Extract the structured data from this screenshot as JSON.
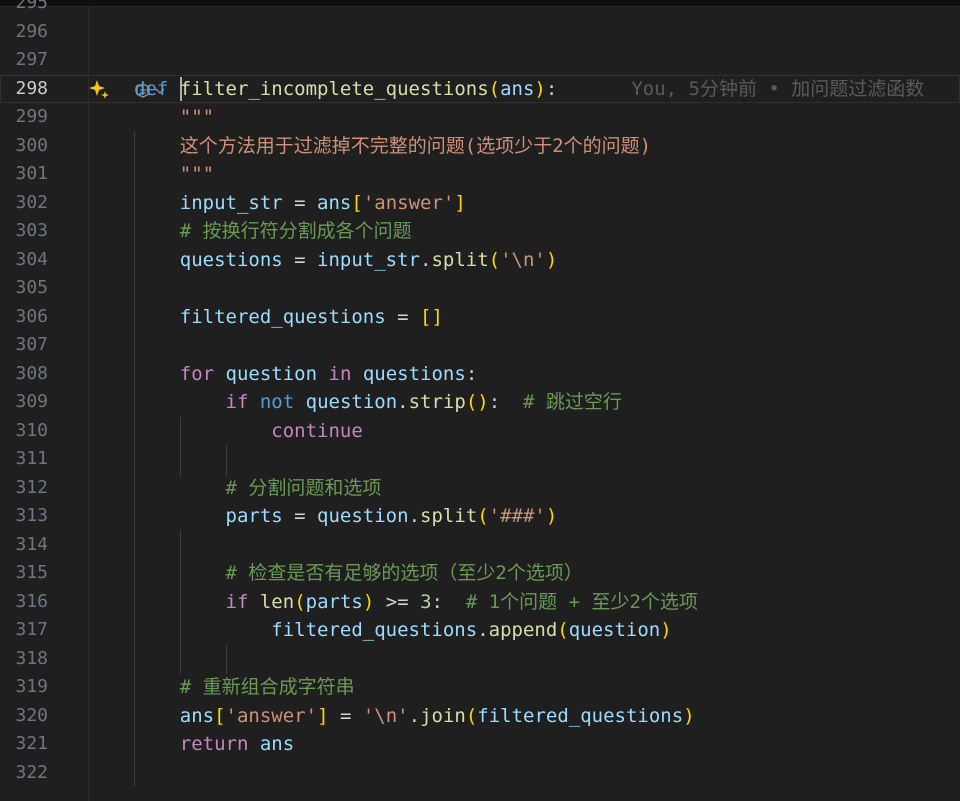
{
  "editor": {
    "lines": [
      {
        "num": "295",
        "tokens": []
      },
      {
        "num": "296",
        "tokens": []
      },
      {
        "num": "297",
        "tokens": []
      },
      {
        "num": "298",
        "current": true,
        "tokens": [
          {
            "t": "def",
            "c": "kw"
          },
          {
            "t": " "
          },
          {
            "t": "filter_incomplete_questions",
            "c": "fn"
          },
          {
            "t": "(",
            "c": "br1"
          },
          {
            "t": "ans",
            "c": "var"
          },
          {
            "t": ")",
            "c": "br1"
          },
          {
            "t": ":"
          }
        ],
        "blame": "You, 5分钟前 • 加问题过滤函数"
      },
      {
        "num": "299",
        "tokens": [
          {
            "t": "    "
          },
          {
            "t": "\"\"\"",
            "c": "str"
          }
        ]
      },
      {
        "num": "300",
        "tokens": [
          {
            "t": "    "
          },
          {
            "t": "这个方法用于过滤掉不完整的问题(选项少于2个的问题)",
            "c": "str"
          }
        ]
      },
      {
        "num": "301",
        "tokens": [
          {
            "t": "    "
          },
          {
            "t": "\"\"\"",
            "c": "str"
          }
        ]
      },
      {
        "num": "302",
        "tokens": [
          {
            "t": "    "
          },
          {
            "t": "input_str",
            "c": "var"
          },
          {
            "t": " = ",
            "c": "op"
          },
          {
            "t": "ans",
            "c": "var"
          },
          {
            "t": "[",
            "c": "br1"
          },
          {
            "t": "'answer'",
            "c": "str"
          },
          {
            "t": "]",
            "c": "br1"
          }
        ]
      },
      {
        "num": "303",
        "tokens": [
          {
            "t": "    "
          },
          {
            "t": "# 按换行符分割成各个问题",
            "c": "cm"
          }
        ]
      },
      {
        "num": "304",
        "tokens": [
          {
            "t": "    "
          },
          {
            "t": "questions",
            "c": "var"
          },
          {
            "t": " = ",
            "c": "op"
          },
          {
            "t": "input_str",
            "c": "var"
          },
          {
            "t": "."
          },
          {
            "t": "split",
            "c": "fn"
          },
          {
            "t": "(",
            "c": "br1"
          },
          {
            "t": "'\\n'",
            "c": "str"
          },
          {
            "t": ")",
            "c": "br1"
          }
        ]
      },
      {
        "num": "305",
        "tokens": []
      },
      {
        "num": "306",
        "tokens": [
          {
            "t": "    "
          },
          {
            "t": "filtered_questions",
            "c": "var"
          },
          {
            "t": " = ",
            "c": "op"
          },
          {
            "t": "[]",
            "c": "br1"
          }
        ]
      },
      {
        "num": "307",
        "tokens": []
      },
      {
        "num": "308",
        "tokens": [
          {
            "t": "    "
          },
          {
            "t": "for",
            "c": "ctl"
          },
          {
            "t": " "
          },
          {
            "t": "question",
            "c": "var"
          },
          {
            "t": " "
          },
          {
            "t": "in",
            "c": "ctl"
          },
          {
            "t": " "
          },
          {
            "t": "questions",
            "c": "var"
          },
          {
            "t": ":"
          }
        ]
      },
      {
        "num": "309",
        "tokens": [
          {
            "t": "        "
          },
          {
            "t": "if",
            "c": "ctl"
          },
          {
            "t": " "
          },
          {
            "t": "not",
            "c": "kw"
          },
          {
            "t": " "
          },
          {
            "t": "question",
            "c": "var"
          },
          {
            "t": "."
          },
          {
            "t": "strip",
            "c": "fn"
          },
          {
            "t": "()",
            "c": "br1"
          },
          {
            "t": ":  "
          },
          {
            "t": "# 跳过空行",
            "c": "cm"
          }
        ]
      },
      {
        "num": "310",
        "tokens": [
          {
            "t": "            "
          },
          {
            "t": "continue",
            "c": "ctl"
          }
        ]
      },
      {
        "num": "311",
        "tokens": []
      },
      {
        "num": "312",
        "tokens": [
          {
            "t": "        "
          },
          {
            "t": "# 分割问题和选项",
            "c": "cm"
          }
        ]
      },
      {
        "num": "313",
        "tokens": [
          {
            "t": "        "
          },
          {
            "t": "parts",
            "c": "var"
          },
          {
            "t": " = ",
            "c": "op"
          },
          {
            "t": "question",
            "c": "var"
          },
          {
            "t": "."
          },
          {
            "t": "split",
            "c": "fn"
          },
          {
            "t": "(",
            "c": "br1"
          },
          {
            "t": "'###'",
            "c": "str"
          },
          {
            "t": ")",
            "c": "br1"
          }
        ]
      },
      {
        "num": "314",
        "tokens": []
      },
      {
        "num": "315",
        "tokens": [
          {
            "t": "        "
          },
          {
            "t": "# 检查是否有足够的选项（至少2个选项）",
            "c": "cm"
          }
        ]
      },
      {
        "num": "316",
        "tokens": [
          {
            "t": "        "
          },
          {
            "t": "if",
            "c": "ctl"
          },
          {
            "t": " "
          },
          {
            "t": "len",
            "c": "fn"
          },
          {
            "t": "(",
            "c": "br1"
          },
          {
            "t": "parts",
            "c": "var"
          },
          {
            "t": ")",
            "c": "br1"
          },
          {
            "t": " >= ",
            "c": "op"
          },
          {
            "t": "3",
            "c": "num"
          },
          {
            "t": ":  "
          },
          {
            "t": "# 1个问题 + 至少2个选项",
            "c": "cm"
          }
        ]
      },
      {
        "num": "317",
        "tokens": [
          {
            "t": "            "
          },
          {
            "t": "filtered_questions",
            "c": "var"
          },
          {
            "t": "."
          },
          {
            "t": "append",
            "c": "fn"
          },
          {
            "t": "(",
            "c": "br1"
          },
          {
            "t": "question",
            "c": "var"
          },
          {
            "t": ")",
            "c": "br1"
          }
        ]
      },
      {
        "num": "318",
        "tokens": []
      },
      {
        "num": "319",
        "tokens": [
          {
            "t": "    "
          },
          {
            "t": "# 重新组合成字符串",
            "c": "cm"
          }
        ]
      },
      {
        "num": "320",
        "tokens": [
          {
            "t": "    "
          },
          {
            "t": "ans",
            "c": "var"
          },
          {
            "t": "[",
            "c": "br1"
          },
          {
            "t": "'answer'",
            "c": "str"
          },
          {
            "t": "]",
            "c": "br1"
          },
          {
            "t": " = ",
            "c": "op"
          },
          {
            "t": "'\\n'",
            "c": "str"
          },
          {
            "t": "."
          },
          {
            "t": "join",
            "c": "fn"
          },
          {
            "t": "(",
            "c": "br1"
          },
          {
            "t": "filtered_questions",
            "c": "var"
          },
          {
            "t": ")",
            "c": "br1"
          }
        ]
      },
      {
        "num": "321",
        "tokens": [
          {
            "t": "    "
          },
          {
            "t": "return",
            "c": "ctl"
          },
          {
            "t": " "
          },
          {
            "t": "ans",
            "c": "var"
          }
        ]
      },
      {
        "num": "322",
        "tokens": []
      }
    ]
  },
  "icons": {
    "sparkle": "sparkle-icon",
    "codelens": "copilot-codelens-icon"
  },
  "colors": {
    "background": "#1f1f1f",
    "keyword": "#569cd6",
    "control": "#c586c0",
    "function": "#dcdcaa",
    "variable": "#9cdcfe",
    "string": "#ce9178",
    "comment": "#6a9955",
    "bracket": "#ffd700"
  }
}
